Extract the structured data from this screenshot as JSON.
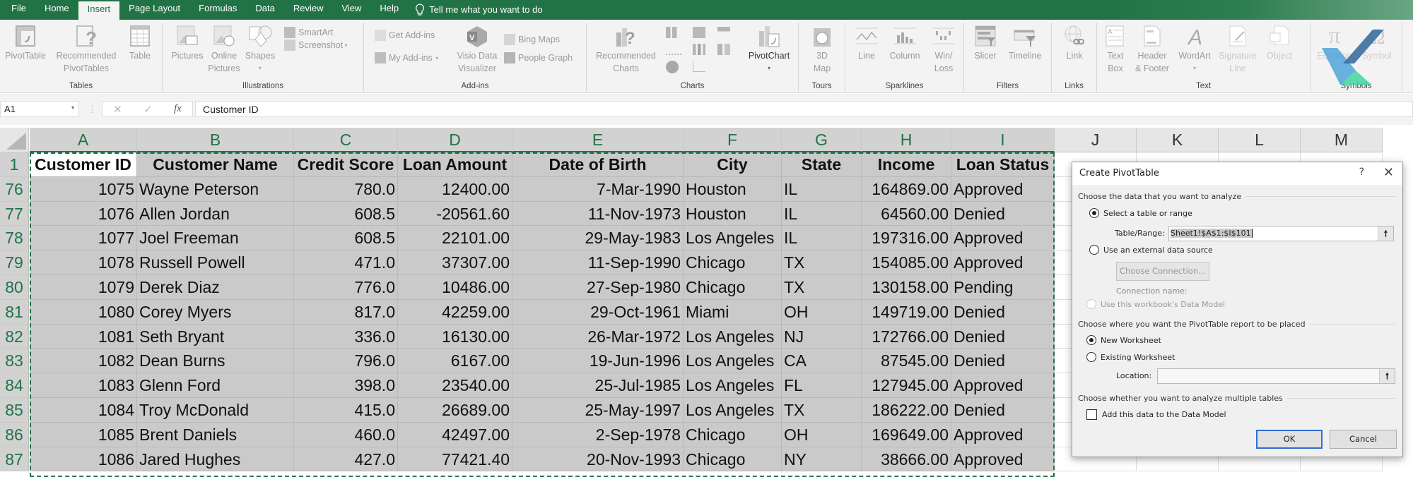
{
  "tabs": [
    {
      "label": "File",
      "active": false
    },
    {
      "label": "Home",
      "active": false
    },
    {
      "label": "Insert",
      "active": true
    },
    {
      "label": "Page Layout",
      "active": false
    },
    {
      "label": "Formulas",
      "active": false
    },
    {
      "label": "Data",
      "active": false
    },
    {
      "label": "Review",
      "active": false
    },
    {
      "label": "View",
      "active": false
    },
    {
      "label": "Help",
      "active": false
    }
  ],
  "tell_me": "Tell me what you want to do",
  "ribbon": {
    "tables": {
      "label": "Tables",
      "pivottable": "PivotTable",
      "recommended_pivottables_1": "Recommended",
      "recommended_pivottables_2": "PivotTables",
      "table": "Table"
    },
    "illustrations": {
      "label": "Illustrations",
      "pictures": "Pictures",
      "online_pictures_1": "Online",
      "online_pictures_2": "Pictures",
      "shapes": "Shapes",
      "smartart": "SmartArt",
      "screenshot": "Screenshot"
    },
    "addins": {
      "label": "Add-ins",
      "get_addins": "Get Add-ins",
      "my_addins": "My Add-ins",
      "visio_1": "Visio Data",
      "visio_2": "Visualizer",
      "bing_maps": "Bing Maps",
      "people_graph": "People Graph"
    },
    "charts": {
      "label": "Charts",
      "recommended_1": "Recommended",
      "recommended_2": "Charts",
      "pivotchart": "PivotChart"
    },
    "tours": {
      "label": "Tours",
      "map_1": "3D",
      "map_2": "Map"
    },
    "sparklines": {
      "label": "Sparklines",
      "line": "Line",
      "column": "Column",
      "winloss_1": "Win/",
      "winloss_2": "Loss"
    },
    "filters": {
      "label": "Filters",
      "slicer": "Slicer",
      "timeline": "Timeline"
    },
    "links": {
      "label": "Links",
      "link": "Link"
    },
    "text": {
      "label": "Text",
      "textbox_1": "Text",
      "textbox_2": "Box",
      "header_1": "Header",
      "header_2": "& Footer",
      "wordart": "WordArt",
      "signature_1": "Signature",
      "signature_2": "Line",
      "object": "Object"
    },
    "symbols": {
      "label": "Symbols",
      "equation": "Equation",
      "symbol": "Symbol"
    }
  },
  "formula_bar": {
    "name_box": "A1",
    "formula": "Customer ID"
  },
  "sheet": {
    "columns": [
      "A",
      "B",
      "C",
      "D",
      "E",
      "F",
      "G",
      "H",
      "I",
      "J",
      "K",
      "L",
      "M"
    ],
    "headers": [
      "Customer ID",
      "Customer Name",
      "Credit Score",
      "Loan Amount",
      "Date of Birth",
      "City",
      "State",
      "Income",
      "Loan Status"
    ],
    "header_row_number": "1",
    "rows": [
      {
        "n": "76",
        "cells": [
          "1075",
          "Wayne Peterson",
          "780.0",
          "12400.00",
          "7-Mar-1990",
          "Houston",
          "IL",
          "164869.00",
          "Approved"
        ]
      },
      {
        "n": "77",
        "cells": [
          "1076",
          "Allen Jordan",
          "608.5",
          "-20561.60",
          "11-Nov-1973",
          "Houston",
          "IL",
          "64560.00",
          "Denied"
        ]
      },
      {
        "n": "78",
        "cells": [
          "1077",
          "Joel Freeman",
          "608.5",
          "22101.00",
          "29-May-1983",
          "Los Angeles",
          "IL",
          "197316.00",
          "Approved"
        ]
      },
      {
        "n": "79",
        "cells": [
          "1078",
          "Russell Powell",
          "471.0",
          "37307.00",
          "11-Sep-1990",
          "Chicago",
          "TX",
          "154085.00",
          "Approved"
        ]
      },
      {
        "n": "80",
        "cells": [
          "1079",
          "Derek Diaz",
          "776.0",
          "10486.00",
          "27-Sep-1980",
          "Chicago",
          "TX",
          "130158.00",
          "Pending"
        ]
      },
      {
        "n": "81",
        "cells": [
          "1080",
          "Corey Myers",
          "817.0",
          "42259.00",
          "29-Oct-1961",
          "Miami",
          "OH",
          "149719.00",
          "Denied"
        ]
      },
      {
        "n": "82",
        "cells": [
          "1081",
          "Seth Bryant",
          "336.0",
          "16130.00",
          "26-Mar-1972",
          "Los Angeles",
          "NJ",
          "172766.00",
          "Denied"
        ]
      },
      {
        "n": "83",
        "cells": [
          "1082",
          "Dean Burns",
          "796.0",
          "6167.00",
          "19-Jun-1996",
          "Los Angeles",
          "CA",
          "87545.00",
          "Denied"
        ]
      },
      {
        "n": "84",
        "cells": [
          "1083",
          "Glenn Ford",
          "398.0",
          "23540.00",
          "25-Jul-1985",
          "Los Angeles",
          "FL",
          "127945.00",
          "Approved"
        ]
      },
      {
        "n": "85",
        "cells": [
          "1084",
          "Troy McDonald",
          "415.0",
          "26689.00",
          "25-May-1997",
          "Los Angeles",
          "TX",
          "186222.00",
          "Denied"
        ]
      },
      {
        "n": "86",
        "cells": [
          "1085",
          "Brent Daniels",
          "460.0",
          "42497.00",
          "2-Sep-1978",
          "Chicago",
          "OH",
          "169649.00",
          "Approved"
        ]
      },
      {
        "n": "87",
        "cells": [
          "1086",
          "Jared Hughes",
          "427.0",
          "77421.40",
          "20-Nov-1993",
          "Chicago",
          "NY",
          "38666.00",
          "Approved"
        ]
      }
    ]
  },
  "dialog": {
    "title": "Create PivotTable",
    "help": "?",
    "close": "✕",
    "section1": "Choose the data that you want to analyze",
    "select_range": "Select a table or range",
    "table_range_label": "Table/Range:",
    "table_range_value": "Sheet1!$A$1:$I$101",
    "external_source": "Use an external data source",
    "choose_connection": "Choose Connection...",
    "connection_name": "Connection name:",
    "data_model_option": "Use this workbook's Data Model",
    "section2": "Choose where you want the PivotTable report to be placed",
    "new_worksheet": "New Worksheet",
    "existing_worksheet": "Existing Worksheet",
    "location_label": "Location:",
    "location_value": "",
    "section3": "Choose whether you want to analyze multiple tables",
    "add_to_model": "Add this data to the Data Model",
    "ok": "OK",
    "cancel": "Cancel",
    "upload_icon": "🠕"
  }
}
